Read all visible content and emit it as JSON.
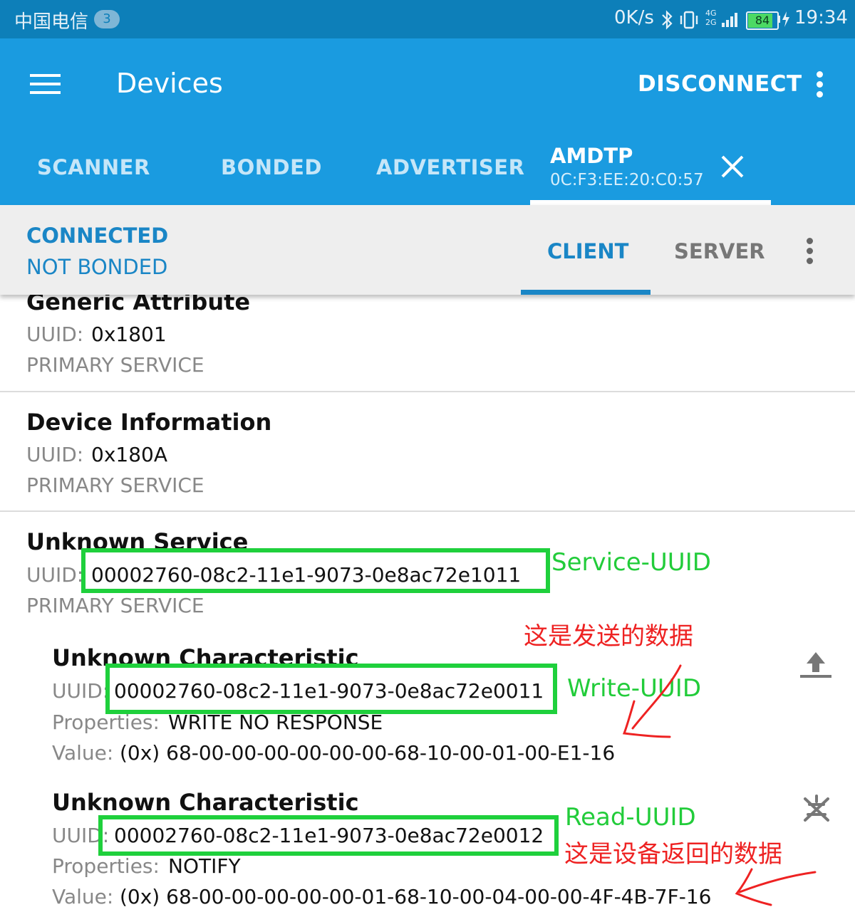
{
  "status_bar": {
    "carrier": "中国电信",
    "sim_badge": "3",
    "net_speed": "0K/s",
    "signal_text": "4G 2G",
    "battery_level": "84",
    "time": "19:34"
  },
  "toolbar": {
    "title": "Devices",
    "disconnect_label": "DISCONNECT"
  },
  "tabs": {
    "scanner": "SCANNER",
    "bonded": "BONDED",
    "advertiser": "ADVERTISER",
    "device_name": "AMDTP",
    "device_address": "0C:F3:EE:20:C0:57"
  },
  "connection": {
    "state": "CONNECTED",
    "bond_state": "NOT BONDED",
    "client_tab": "CLIENT",
    "server_tab": "SERVER"
  },
  "services": [
    {
      "name": "Generic Attribute",
      "uuid_label": "UUID:",
      "uuid": "0x1801",
      "type": "PRIMARY SERVICE"
    },
    {
      "name": "Device Information",
      "uuid_label": "UUID:",
      "uuid": "0x180A",
      "type": "PRIMARY SERVICE"
    },
    {
      "name": "Unknown Service",
      "uuid_label": "UUID:",
      "uuid": "00002760-08c2-11e1-9073-0e8ac72e1011",
      "type": "PRIMARY SERVICE"
    }
  ],
  "characteristics": [
    {
      "name": "Unknown Characteristic",
      "uuid_label": "UUID:",
      "uuid": "00002760-08c2-11e1-9073-0e8ac72e0011",
      "properties_label": "Properties:",
      "properties": "WRITE NO RESPONSE",
      "value_label": "Value:",
      "value": "(0x) 68-00-00-00-00-00-00-68-10-00-01-00-E1-16",
      "action_icon": "upload-icon"
    },
    {
      "name": "Unknown Characteristic",
      "uuid_label": "UUID:",
      "uuid": "00002760-08c2-11e1-9073-0e8ac72e0012",
      "properties_label": "Properties:",
      "properties": "NOTIFY",
      "value_label": "Value:",
      "value": "(0x) 68-00-00-00-00-00-01-68-10-00-04-00-00-4F-4B-7F-16",
      "action_icon": "notifications-off-icon"
    }
  ],
  "annotations": {
    "service_uuid": "Service-UUID",
    "write_uuid": "Write-UUID",
    "read_uuid": "Read-UUID",
    "sent_data": "这是发送的数据",
    "returned_data": "这是设备返回的数据",
    "green_color": "#1fd03c",
    "red_color": "#ee2222"
  },
  "colors": {
    "status_bar": "#0d7fb9",
    "toolbar": "#1a9be0",
    "accent": "#1a86c6"
  }
}
